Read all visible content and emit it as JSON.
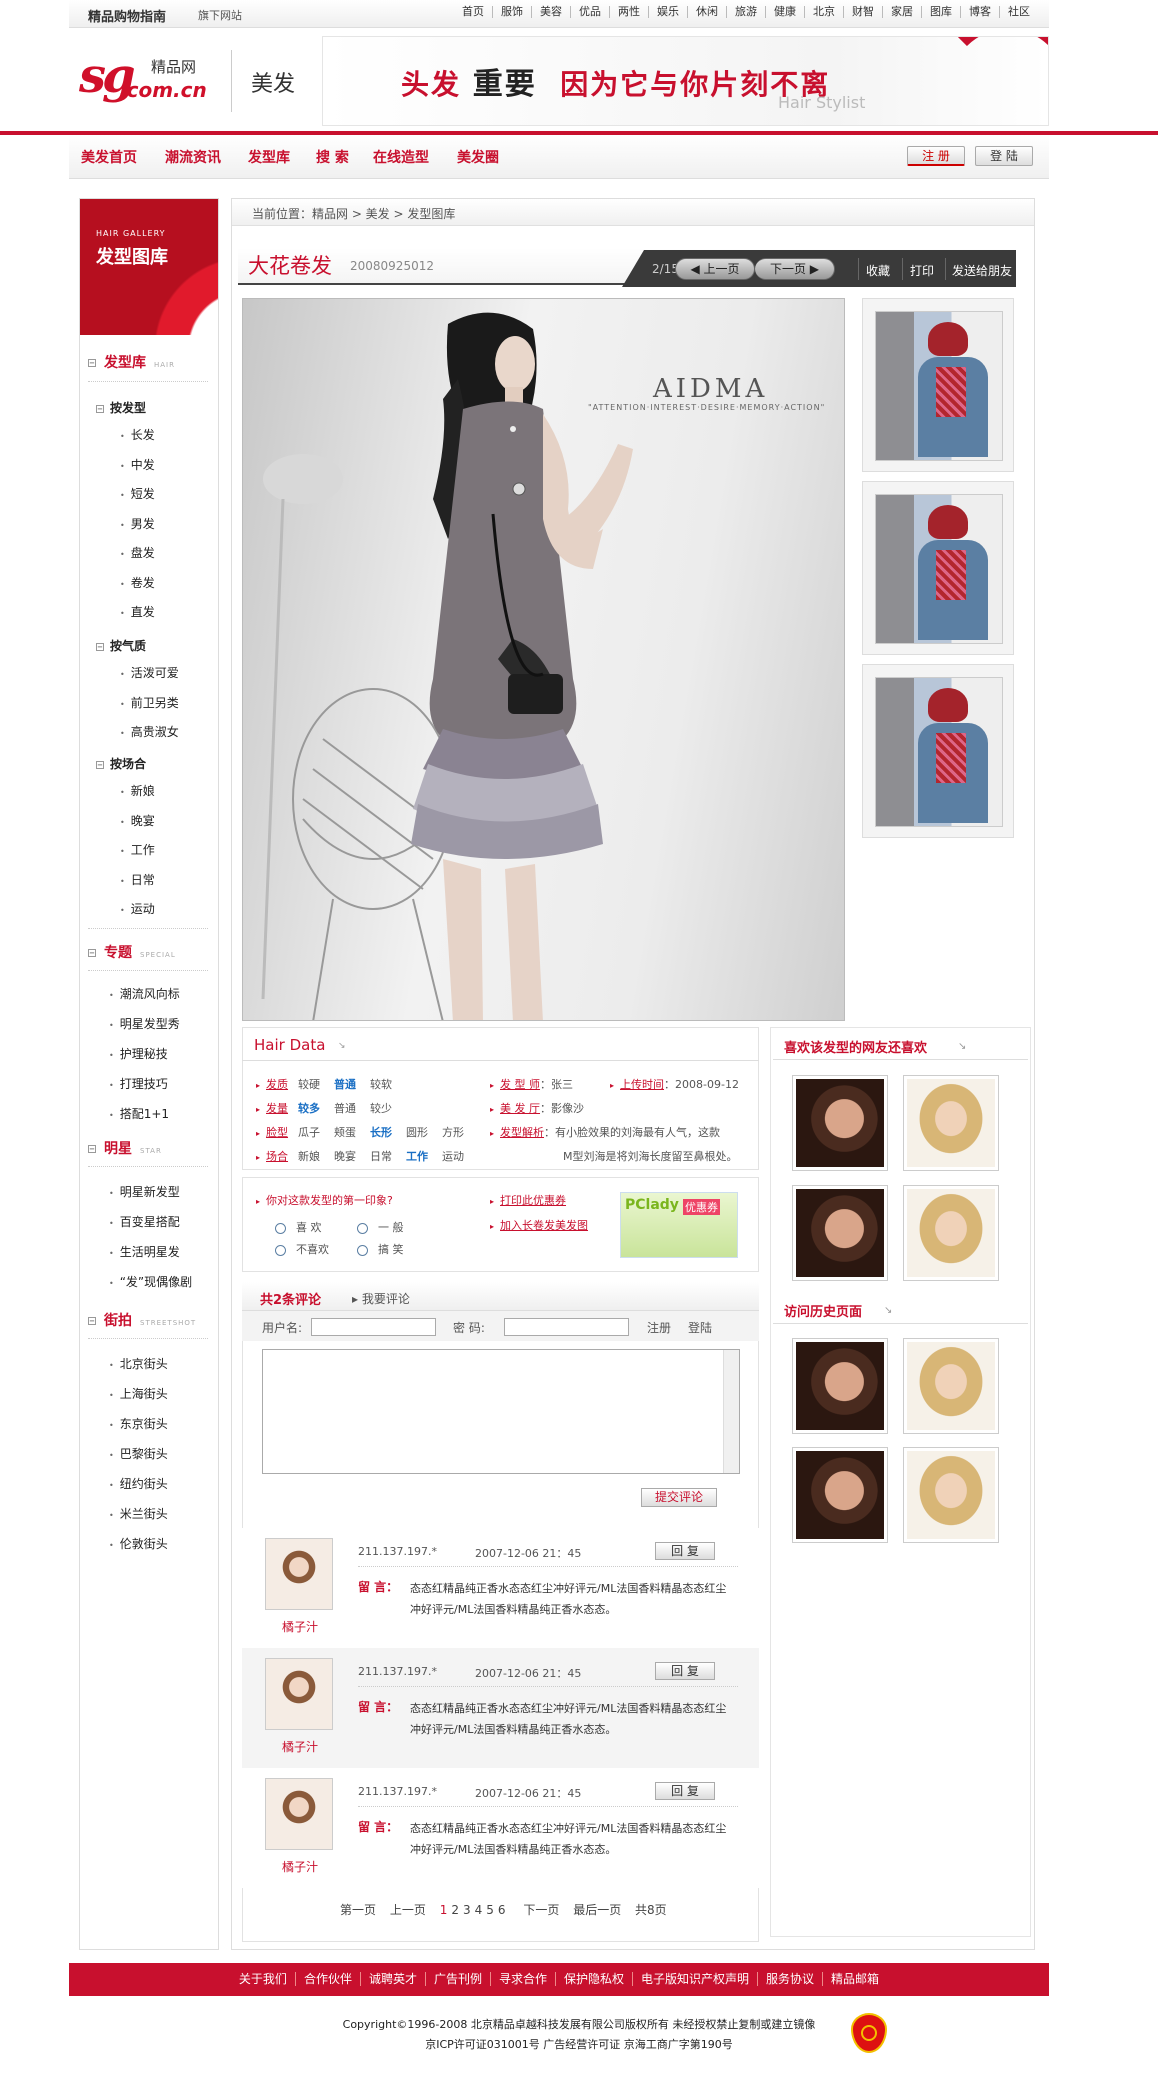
{
  "topbar": {
    "brand": "精品购物指南",
    "subsite": "旗下网站",
    "nav": [
      "首页",
      "服饰",
      "美容",
      "优品",
      "两性",
      "娱乐",
      "休闲",
      "旅游",
      "健康",
      "北京",
      "财智",
      "家居",
      "图库",
      "博客",
      "社区"
    ]
  },
  "header": {
    "logo_sg": "sg",
    "logo_cn": ".com.cn",
    "logo_name": "精品网",
    "channel": "美发",
    "banner_title_a": "头发",
    "banner_title_b": "重要",
    "banner_title_c": "因为它与你片刻不离",
    "banner_sub": "Hair Stylist"
  },
  "mainnav": {
    "items": [
      "美发首页",
      "潮流资讯",
      "发型库",
      "搜 索",
      "在线造型",
      "美发圈"
    ],
    "register": "注 册",
    "login": "登 陆"
  },
  "sidebar": {
    "head_en": "HAIR GALLERY",
    "head_cn": "发型图库",
    "sec1": {
      "title": "发型库",
      "en": "HAIR"
    },
    "g1": {
      "title": "按发型",
      "items": [
        "长发",
        "中发",
        "短发",
        "男发",
        "盘发",
        "卷发",
        "直发"
      ]
    },
    "g2": {
      "title": "按气质",
      "items": [
        "活泼可爱",
        "前卫另类",
        "高贵淑女"
      ]
    },
    "g3": {
      "title": "按场合",
      "items": [
        "新娘",
        "晚宴",
        "工作",
        "日常",
        "运动"
      ]
    },
    "sec2": {
      "title": "专题",
      "en": "SPECIAL",
      "items": [
        "潮流风向标",
        "明星发型秀",
        "护理秘技",
        "打理技巧",
        "搭配1+1"
      ]
    },
    "sec3": {
      "title": "明星",
      "en": "STAR",
      "items": [
        "明星新发型",
        "百变星搭配",
        "生活明星发",
        "“发”现偶像剧"
      ]
    },
    "sec4": {
      "title": "街拍",
      "en": "STREETSHOT",
      "items": [
        "北京街头",
        "上海街头",
        "东京街头",
        "巴黎街头",
        "纽约街头",
        "米兰街头",
        "伦敦街头"
      ]
    }
  },
  "breadcrumb": {
    "text": "当前位置：精品网 > 美发 > 发型图库"
  },
  "gallery": {
    "title": "大花卷发",
    "code": "20080925012",
    "page": "2/15",
    "prev": "上一页",
    "next": "下一页",
    "actions": [
      "收藏",
      "打印",
      "发送给朋友"
    ],
    "photo_text": "AIDMA",
    "photo_sub": "\"ATTENTION·INTEREST·DESIRE·MEMORY·ACTION\""
  },
  "hairdata": {
    "title": "Hair Data",
    "rows": [
      {
        "key": "发质",
        "opts": [
          "较硬",
          "普通",
          "较软"
        ],
        "hl": 1
      },
      {
        "key": "发量",
        "opts": [
          "较多",
          "普通",
          "较少"
        ],
        "hl": 0
      },
      {
        "key": "脸型",
        "opts": [
          "瓜子",
          "颊蛋",
          "长形",
          "圆形",
          "方形"
        ],
        "hl": 2
      },
      {
        "key": "场合",
        "opts": [
          "新娘",
          "晚宴",
          "日常",
          "工作",
          "运动"
        ],
        "hl": 3
      }
    ],
    "stylist_k": "发 型 师",
    "stylist_v": "：张三",
    "salon_k": "美 发 厅",
    "salon_v": "：影像沙",
    "time_k": "上传时间",
    "time_v": "：2008-09-12",
    "analysis_k": "发型解析",
    "analysis_v": "：有小脸效果的刘海最有人气，这款",
    "analysis_v2": "M型刘海是将刘海长度留至鼻根处。"
  },
  "vote": {
    "question": "你对这款发型的第一印象?",
    "o1": "喜  欢",
    "o2": "一  般",
    "o3": "不喜欢",
    "o4": "搞  笑",
    "link1": "打印此优惠券",
    "link2": "加入长卷发美发图",
    "ad_brand": "PClady",
    "ad_tag": "优惠券"
  },
  "comments": {
    "count_label": "共2条评论",
    "write": "我要评论",
    "user_label": "用户名:",
    "pwd_label": "密  码:",
    "reg": "注册",
    "login": "登陆",
    "submit": "提交评论",
    "list": [
      {
        "name": "橘子汁",
        "ip": "211.137.197.*",
        "time": "2007-12-06 21：45",
        "reply": "回 复",
        "label": "留  言：",
        "text": "态态红精晶纯正香水态态红尘冲好评元/ML法国香料精晶态态红尘冲好评元/ML法国香料精晶纯正香水态态。"
      },
      {
        "name": "橘子汁",
        "ip": "211.137.197.*",
        "time": "2007-12-06 21：45",
        "reply": "回 复",
        "label": "留  言：",
        "text": "态态红精晶纯正香水态态红尘冲好评元/ML法国香料精晶态态红尘冲好评元/ML法国香料精晶纯正香水态态。"
      },
      {
        "name": "橘子汁",
        "ip": "211.137.197.*",
        "time": "2007-12-06 21：45",
        "reply": "回 复",
        "label": "留  言：",
        "text": "态态红精晶纯正香水态态红尘冲好评元/ML法国香料精晶态态红尘冲好评元/ML法国香料精晶纯正香水态态。"
      }
    ],
    "pager": {
      "first": "第一页",
      "prev": "上一页",
      "pages": [
        "1",
        "2",
        "3",
        "4",
        "5",
        "6"
      ],
      "next": "下一页",
      "last": "最后一页",
      "total": "共8页"
    }
  },
  "right": {
    "like_title": "喜欢该发型的网友还喜欢",
    "history_title": "访问历史页面"
  },
  "footer": {
    "links": [
      "关于我们",
      "合作伙伴",
      "诚聘英才",
      "广告刊例",
      "寻求合作",
      "保护隐私权",
      "电子版知识产权声明",
      "服务协议",
      "精品邮箱"
    ],
    "copyright": "Copyright©1996-2008 北京精品卓越科技发展有限公司版权所有 未经授权禁止复制或建立镜像",
    "icp": "京ICP许可证031001号  广告经营许可证 京海工商广字第190号"
  },
  "colors": {
    "brand_red": "#c8102e",
    "link_blue": "#1a6fc4"
  }
}
